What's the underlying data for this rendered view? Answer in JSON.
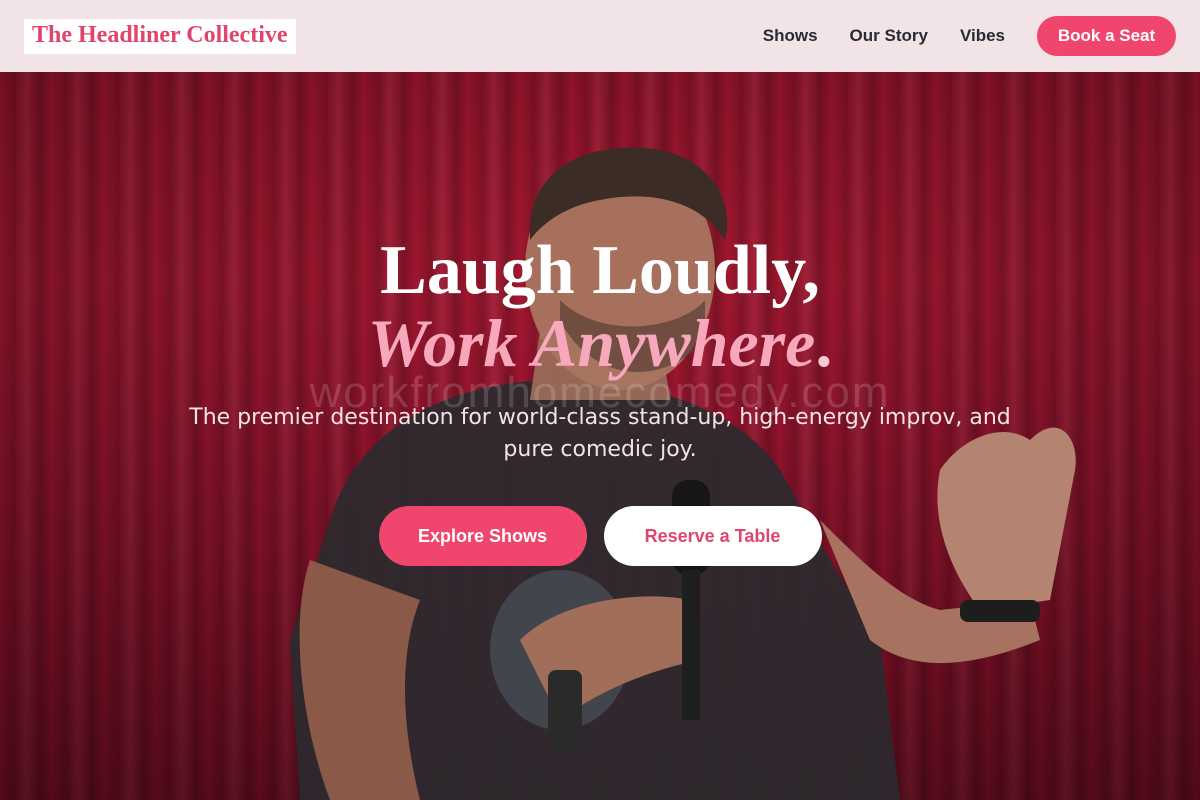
{
  "header": {
    "logo": "The Headliner Collective",
    "nav": [
      {
        "label": "Shows"
      },
      {
        "label": "Our Story"
      },
      {
        "label": "Vibes"
      }
    ],
    "cta": "Book a Seat"
  },
  "hero": {
    "headline_line1": "Laugh Loudly,",
    "headline_line2": "Work Anywhere",
    "headline_line2_punct": ".",
    "subtitle": "The premier destination for world-class stand-up, high-energy improv, and pure comedic joy.",
    "watermark": "workfromhomecomedy.com",
    "primary_button": "Explore Shows",
    "secondary_button": "Reserve a Table"
  },
  "colors": {
    "accent": "#f0466e",
    "logo_text": "#e0466d",
    "curtain": "#a3152e",
    "headline_italic": "#f7a8bc"
  }
}
